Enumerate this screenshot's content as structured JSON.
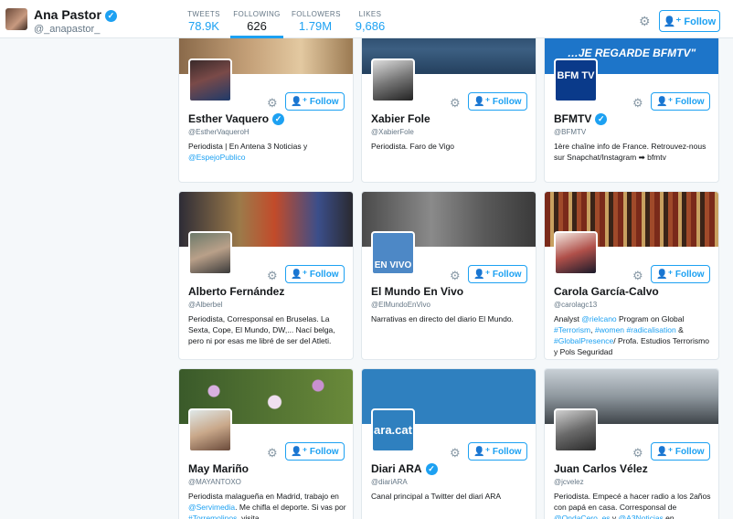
{
  "profile": {
    "name": "Ana Pastor",
    "handle": "@_anapastor_",
    "follow_label": "Follow"
  },
  "stats": [
    {
      "label": "TWEETS",
      "value": "78.9K"
    },
    {
      "label": "FOLLOWING",
      "value": "626"
    },
    {
      "label": "FOLLOWERS",
      "value": "1.79M"
    },
    {
      "label": "LIKES",
      "value": "9,686"
    }
  ],
  "cards": [
    {
      "name": "Esther Vaquero",
      "handle": "@EstherVaqueroH",
      "verified": true,
      "bio": [
        "Periodista | En Antena 3 Noticias y ",
        {
          "link": "@EspejoPublico"
        }
      ]
    },
    {
      "name": "Xabier Fole",
      "handle": "@XabierFole",
      "verified": false,
      "bio": [
        "Periodista. Faro de Vigo"
      ]
    },
    {
      "name": "BFMTV",
      "handle": "@BFMTV",
      "verified": true,
      "banner_text": "…JE REGARDE BFMTV\"",
      "logo_text": "BFM TV",
      "bio": [
        "1ère chaîne info de France. Retrouvez-nous sur Snapchat/Instagram ➡ bfmtv"
      ]
    },
    {
      "name": "Alberto Fernández",
      "handle": "@Alberbel",
      "verified": false,
      "bio": [
        "Periodista, Corresponsal en Bruselas. La Sexta, Cope, El Mundo, DW,... Nací belga, pero ni por esas me libré de ser del Atleti."
      ]
    },
    {
      "name": "El Mundo En Vivo",
      "handle": "@ElMundoEnVivo",
      "verified": false,
      "logo_text": "EN VIVO",
      "bio": [
        "Narrativas en directo del diario El Mundo."
      ]
    },
    {
      "name": "Carola García-Calvo",
      "handle": "@carolagc13",
      "verified": false,
      "bio": [
        "Analyst ",
        {
          "link": "@rielcano"
        },
        " Program on Global ",
        {
          "link": "#Terrorism"
        },
        ", ",
        {
          "link": "#women"
        },
        " ",
        {
          "link": "#radicalisation"
        },
        " & ",
        {
          "link": "#GlobalPresence"
        },
        "/ Profa. Estudios Terrorismo y Pols Seguridad"
      ]
    },
    {
      "name": "May Mariño",
      "handle": "@MAYANTOXO",
      "verified": false,
      "bio": [
        "Periodista malagueña en Madrid, trabajo en ",
        {
          "link": "@Servimedia"
        },
        ". Me chifla el deporte. Si vas por ",
        {
          "link": "#Torremolinos"
        },
        ", visita..."
      ]
    },
    {
      "name": "Diari ARA",
      "handle": "@diariARA",
      "verified": true,
      "logo_text": "ara.cat",
      "bio": [
        "Canal principal a Twitter del diari ARA"
      ]
    },
    {
      "name": "Juan Carlos Vélez",
      "handle": "@jcvelez",
      "verified": false,
      "bio": [
        "Periodista. Empecé a hacer radio a los 2años con papá en casa. Corresponsal de ",
        {
          "link": "@OndaCero_es"
        },
        " y ",
        {
          "link": "@A3Noticias"
        },
        " en ..."
      ]
    }
  ]
}
